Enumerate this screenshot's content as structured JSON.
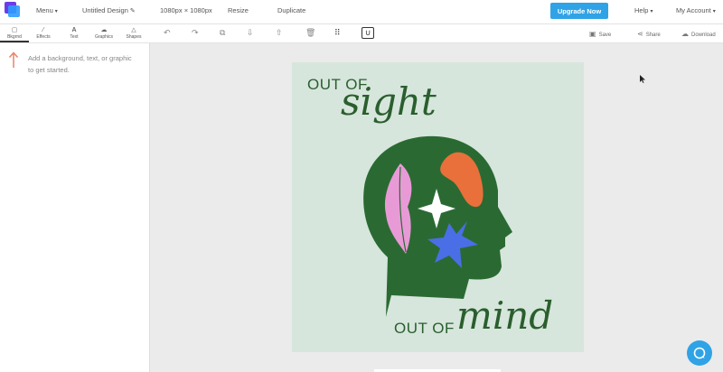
{
  "topbar": {
    "menu": "Menu",
    "design_name": "Untitled Design",
    "dimensions": "1080px × 1080px",
    "resize": "Resize",
    "duplicate": "Duplicate",
    "upgrade": "Upgrade Now",
    "help": "Help",
    "account": "My Account"
  },
  "toolbar": {
    "tabs": [
      "Bkgrnd",
      "Effects",
      "Text",
      "Graphics",
      "Shapes"
    ],
    "save": "Save",
    "share": "Share",
    "download": "Download"
  },
  "sidebar": {
    "hint": "Add a background, text, or graphic to get started."
  },
  "design": {
    "line1": "OUT OF",
    "line2": "sight",
    "line3": "OUT OF",
    "line4": "mind",
    "colors": {
      "background": "#d6e6dc",
      "head": "#2a6a32",
      "leaf": "#e89ad6",
      "blob": "#e9703a",
      "star": "#4a6ee6",
      "sparkle": "#ffffff"
    }
  },
  "colors": {
    "accent": "#2fa3e6",
    "workspace": "#ebebeb"
  }
}
